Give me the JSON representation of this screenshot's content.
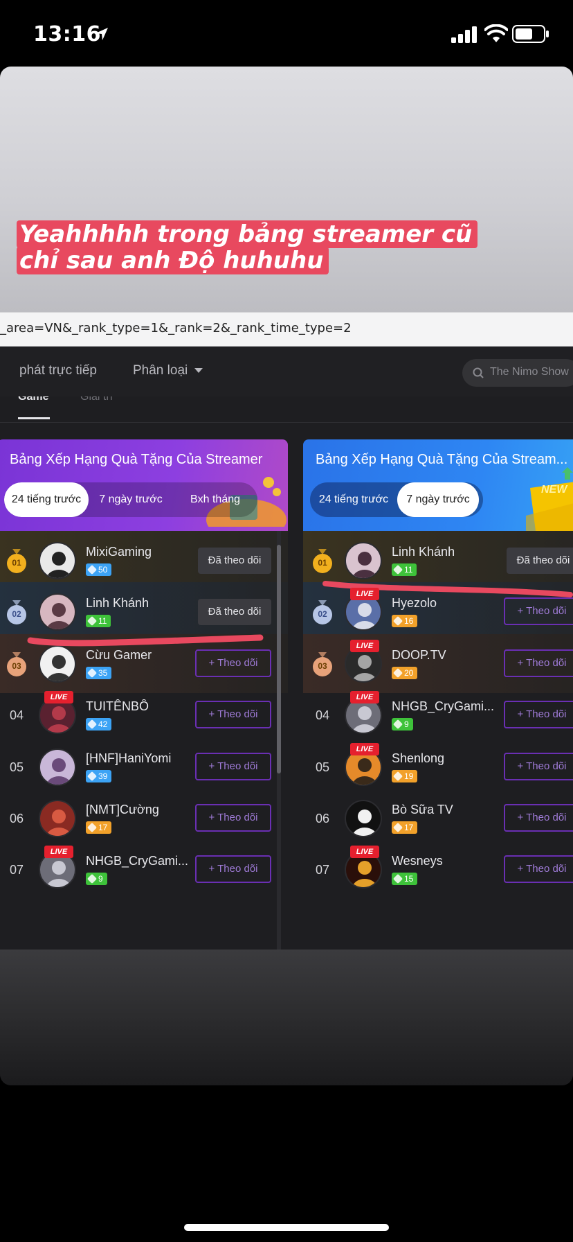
{
  "status_bar": {
    "time": "13:16"
  },
  "story": {
    "caption_line1": "Yeahhhhh trong bảng  streamer cũ",
    "caption_line2": "chỉ sau anh Độ huhuhu"
  },
  "browser": {
    "url": "_area=VN&_rank_type=1&_rank=2&_rank_time_type=2"
  },
  "site_nav": {
    "live_label": "phát trực tiếp",
    "category_label": "Phân loại",
    "search_placeholder": "The Nimo Show",
    "tab_game": "Game",
    "tab_entertainment": "Giải trí"
  },
  "colors": {
    "medal_gold": "#f2b01e",
    "medal_silver": "#b7c6e6",
    "medal_bronze": "#e7a27a",
    "live_red": "#e5202e",
    "follow_purple": "#6a2fb3",
    "annotation_red": "#e8495f"
  },
  "panels": [
    {
      "title": "Bảng Xếp Hạng Quà Tặng Của Streamer",
      "tabs": [
        "24 tiếng trước",
        "7 ngày trước",
        "Bxh tháng"
      ],
      "active_tab": "24 tiếng trước",
      "rows": [
        {
          "rank": "01",
          "name": "MixiGaming",
          "level": "50",
          "live": false,
          "button": "Đã theo dõi"
        },
        {
          "rank": "02",
          "name": "Linh Khánh",
          "level": "11",
          "live": false,
          "button": "Đã theo dõi"
        },
        {
          "rank": "03",
          "name": "Cừu Gamer",
          "level": "35",
          "live": false,
          "button": "+ Theo dõi"
        },
        {
          "rank": "04",
          "name": "TUITÊNBÔ",
          "level": "42",
          "live": true,
          "button": "+ Theo dõi"
        },
        {
          "rank": "05",
          "name": "[HNF]HaniYomi",
          "level": "39",
          "live": false,
          "button": "+ Theo dõi"
        },
        {
          "rank": "06",
          "name": "[NMT]Cường",
          "level": "17",
          "live": false,
          "button": "+ Theo dõi"
        },
        {
          "rank": "07",
          "name": "NHGB_CryGami...",
          "level": "9",
          "live": true,
          "button": "+ Theo dõi"
        }
      ]
    },
    {
      "title": "Bảng Xếp Hạng Quà Tặng Của Stream...",
      "tabs": [
        "24 tiếng trước",
        "7 ngày trước"
      ],
      "active_tab": "7 ngày trước",
      "badge": "NEW",
      "rows": [
        {
          "rank": "01",
          "name": "Linh Khánh",
          "level": "11",
          "live": false,
          "button": "Đã theo dõi"
        },
        {
          "rank": "02",
          "name": "Hyezolo",
          "level": "16",
          "live": true,
          "button": "+ Theo dõi"
        },
        {
          "rank": "03",
          "name": "DOOP.TV",
          "level": "20",
          "live": true,
          "button": "+ Theo dõi"
        },
        {
          "rank": "04",
          "name": "NHGB_CryGami...",
          "level": "9",
          "live": true,
          "button": "+ Theo dõi"
        },
        {
          "rank": "05",
          "name": "Shenlong",
          "level": "19",
          "live": true,
          "button": "+ Theo dõi"
        },
        {
          "rank": "06",
          "name": "Bò Sữa TV",
          "level": "17",
          "live": false,
          "button": "+ Theo dõi"
        },
        {
          "rank": "07",
          "name": "Wesneys",
          "level": "15",
          "live": true,
          "button": "+ Theo dõi"
        }
      ]
    }
  ],
  "live_label": "LIVE"
}
